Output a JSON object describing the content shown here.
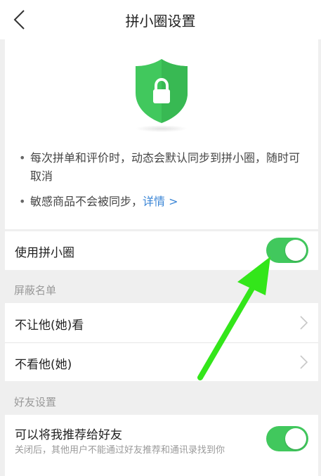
{
  "header": {
    "title": "拼小圈设置"
  },
  "info": {
    "bullet_dot": "•",
    "bullet1": "每次拼单和评价时，动态会默认同步到拼小圈，随时可取消",
    "bullet2_text": "敏感商品不会被同步，",
    "bullet2_link": "详情 >"
  },
  "settings": {
    "use_label": "使用拼小圈",
    "use_enabled": true,
    "block_section": "屏蔽名单",
    "block_items": [
      {
        "label": "不让他(她)看"
      },
      {
        "label": "不看他(她)"
      }
    ],
    "friend_section": "好友设置",
    "recommend_label": "可以将我推荐给好友",
    "recommend_desc": "关闭后，其他用户不能通过好友推荐和通讯录找到你",
    "recommend_enabled": true
  },
  "colors": {
    "accent_green": "#41c85d",
    "link_blue": "#3b86d6",
    "annotation_arrow": "#33e61a"
  },
  "icons": {
    "back": "chevron-left-icon",
    "shield": "shield-lock-icon",
    "row_chevron": "chevron-right-icon"
  }
}
